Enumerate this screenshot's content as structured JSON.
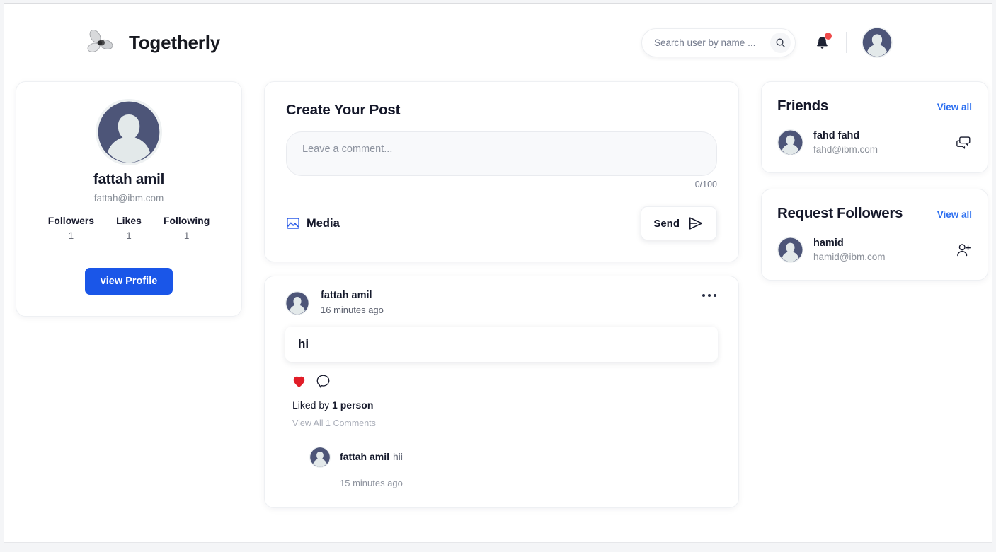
{
  "header": {
    "brand_title": "Togetherly",
    "logo_icon": "propeller-logo",
    "search": {
      "placeholder": "Search user by name ...",
      "value": "",
      "icon": "search-icon"
    },
    "notifications": {
      "icon": "bell-icon",
      "has_unread": true,
      "badge_color": "#ef4a4a"
    },
    "avatar_icon": "user-avatar"
  },
  "profile": {
    "avatar_icon": "user-avatar",
    "name": "fattah amil",
    "email": "fattah@ibm.com",
    "stats": [
      {
        "label": "Followers",
        "value": "1"
      },
      {
        "label": "Likes",
        "value": "1"
      },
      {
        "label": "Following",
        "value": "1"
      }
    ],
    "view_profile_label": "view Profile",
    "primary_color": "#1a56e8"
  },
  "create_post": {
    "title": "Create Your Post",
    "placeholder": "Leave a comment...",
    "value": "",
    "char_counter": "0/100",
    "media_label": "Media",
    "media_icon": "image-icon",
    "media_icon_color": "#2b5ce8",
    "send_label": "Send",
    "send_icon": "paper-plane-icon"
  },
  "feed": {
    "posts": [
      {
        "avatar_icon": "user-avatar",
        "author": "fattah amil",
        "time": "16 minutes ago",
        "menu_icon": "more-options-icon",
        "content": "hi",
        "like_icon": "heart-filled-icon",
        "like_color": "#e11d28",
        "comment_icon": "comment-bubble-icon",
        "liked_by_prefix": "Liked by ",
        "liked_by_count": "1 person",
        "view_comments_label": "View All 1 Comments",
        "comments": [
          {
            "avatar_icon": "user-avatar",
            "author": "fattah amil",
            "text": "hii",
            "time": "15 minutes ago"
          }
        ]
      }
    ]
  },
  "sidebar": {
    "friends": {
      "title": "Friends",
      "view_all_label": "View all",
      "people": [
        {
          "avatar_icon": "user-avatar",
          "name": "fahd fahd",
          "email": "fahd@ibm.com",
          "action_icon": "chat-bubbles-icon"
        }
      ]
    },
    "requests": {
      "title": "Request Followers",
      "view_all_label": "View all",
      "people": [
        {
          "avatar_icon": "user-avatar",
          "name": "hamid",
          "email": "hamid@ibm.com",
          "action_icon": "add-user-icon"
        }
      ]
    }
  }
}
